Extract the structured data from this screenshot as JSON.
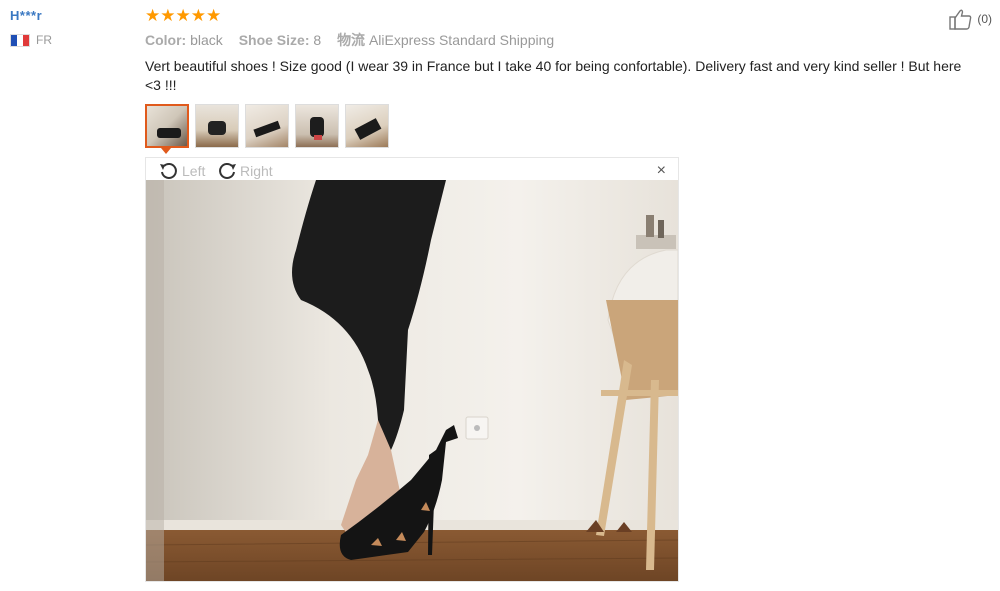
{
  "user": {
    "name": "H***r",
    "country": "FR"
  },
  "rating": {
    "stars": 5,
    "max": 5
  },
  "attributes": [
    {
      "key": "Color:",
      "value": "black"
    },
    {
      "key": "Shoe Size:",
      "value": "8"
    },
    {
      "key": "物流",
      "value": "AliExpress Standard Shipping"
    }
  ],
  "review": {
    "text": "Vert beautiful shoes ! Size good (I wear 39 in France but I take 40 for being confortable). Delivery fast and very kind seller ! But here <3 !!!"
  },
  "helpful": {
    "count": "(0)"
  },
  "viewer": {
    "rotate_left": "Left",
    "rotate_right": "Right",
    "close": "×"
  },
  "colors": {
    "accent": "#e05a1c",
    "star": "#ff9900",
    "username": "#3a78c2"
  }
}
